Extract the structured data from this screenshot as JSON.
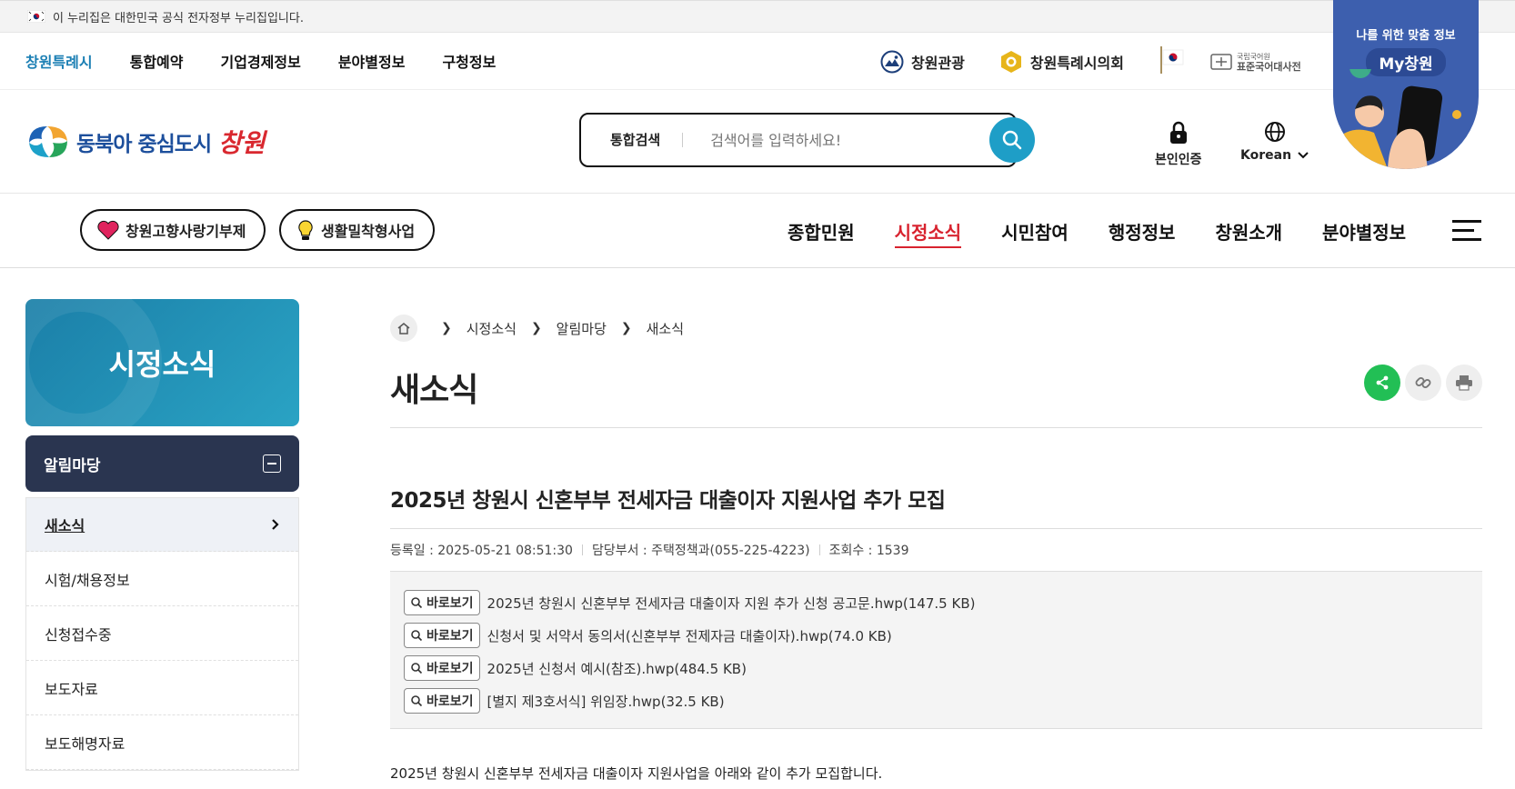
{
  "gov_banner": {
    "text": "이 누리집은 대한민국 공식 전자정부 누리집입니다."
  },
  "topnav": {
    "links": [
      "창원특례시",
      "통합예약",
      "기업경제정보",
      "분야별정보",
      "구청정보"
    ],
    "active_index": 0,
    "right_links": [
      "창원관광",
      "창원특례시의회"
    ],
    "dict_label": "표준국어대사전",
    "dict_sub": "국립국어원"
  },
  "my_badge": {
    "line1": "나를 위한 맞춤 정보",
    "line2": "My창원"
  },
  "header": {
    "logo_text": "동북아 중심도시",
    "logo_script": "창원",
    "search_label": "통합검색",
    "search_placeholder": "검색어를 입력하세요!",
    "auth_label": "본인인증",
    "lang_label": "Korean"
  },
  "gnb": {
    "pills": [
      "창원고향사랑기부제",
      "생활밀착형사업"
    ],
    "menu": [
      "종합민원",
      "시정소식",
      "시민참여",
      "행정정보",
      "창원소개",
      "분야별정보"
    ],
    "active_index": 1
  },
  "side": {
    "title": "시정소식",
    "category": "알림마당",
    "items": [
      "새소식",
      "시험/채용정보",
      "신청접수중",
      "보도자료",
      "보도해명자료"
    ],
    "active_index": 0
  },
  "main": {
    "breadcrumb": [
      "시정소식",
      "알림마당",
      "새소식"
    ],
    "page_title": "새소식",
    "article_title": "2025년 창원시 신혼부부 전세자금 대출이자 지원사업 추가 모집",
    "meta": {
      "registered": "등록일 : 2025-05-21 08:51:30",
      "department": "담당부서 : 주택정책과(055-225-4223)",
      "views": "조회수 : 1539"
    },
    "view_label": "바로보기",
    "files": [
      "2025년 창원시 신혼부부 전세자금 대출이자 지원 추가 신청 공고문.hwp(147.5 KB)",
      "신청서 및 서약서 동의서(신혼부부 전제자금 대출이자).hwp(74.0 KB)",
      "2025년 신청서 예시(참조).hwp(484.5 KB)",
      "[별지 제3호서식] 위임장.hwp(32.5 KB)"
    ],
    "body": "2025년 창원시 신혼부부 전세자금 대출이자 지원사업을 아래와 같이 추가 모집합니다."
  },
  "colors": {
    "accent": "#1e9ec7",
    "active_menu": "#d8232f",
    "share": "#22bf55",
    "side_cat": "#2a3550"
  }
}
